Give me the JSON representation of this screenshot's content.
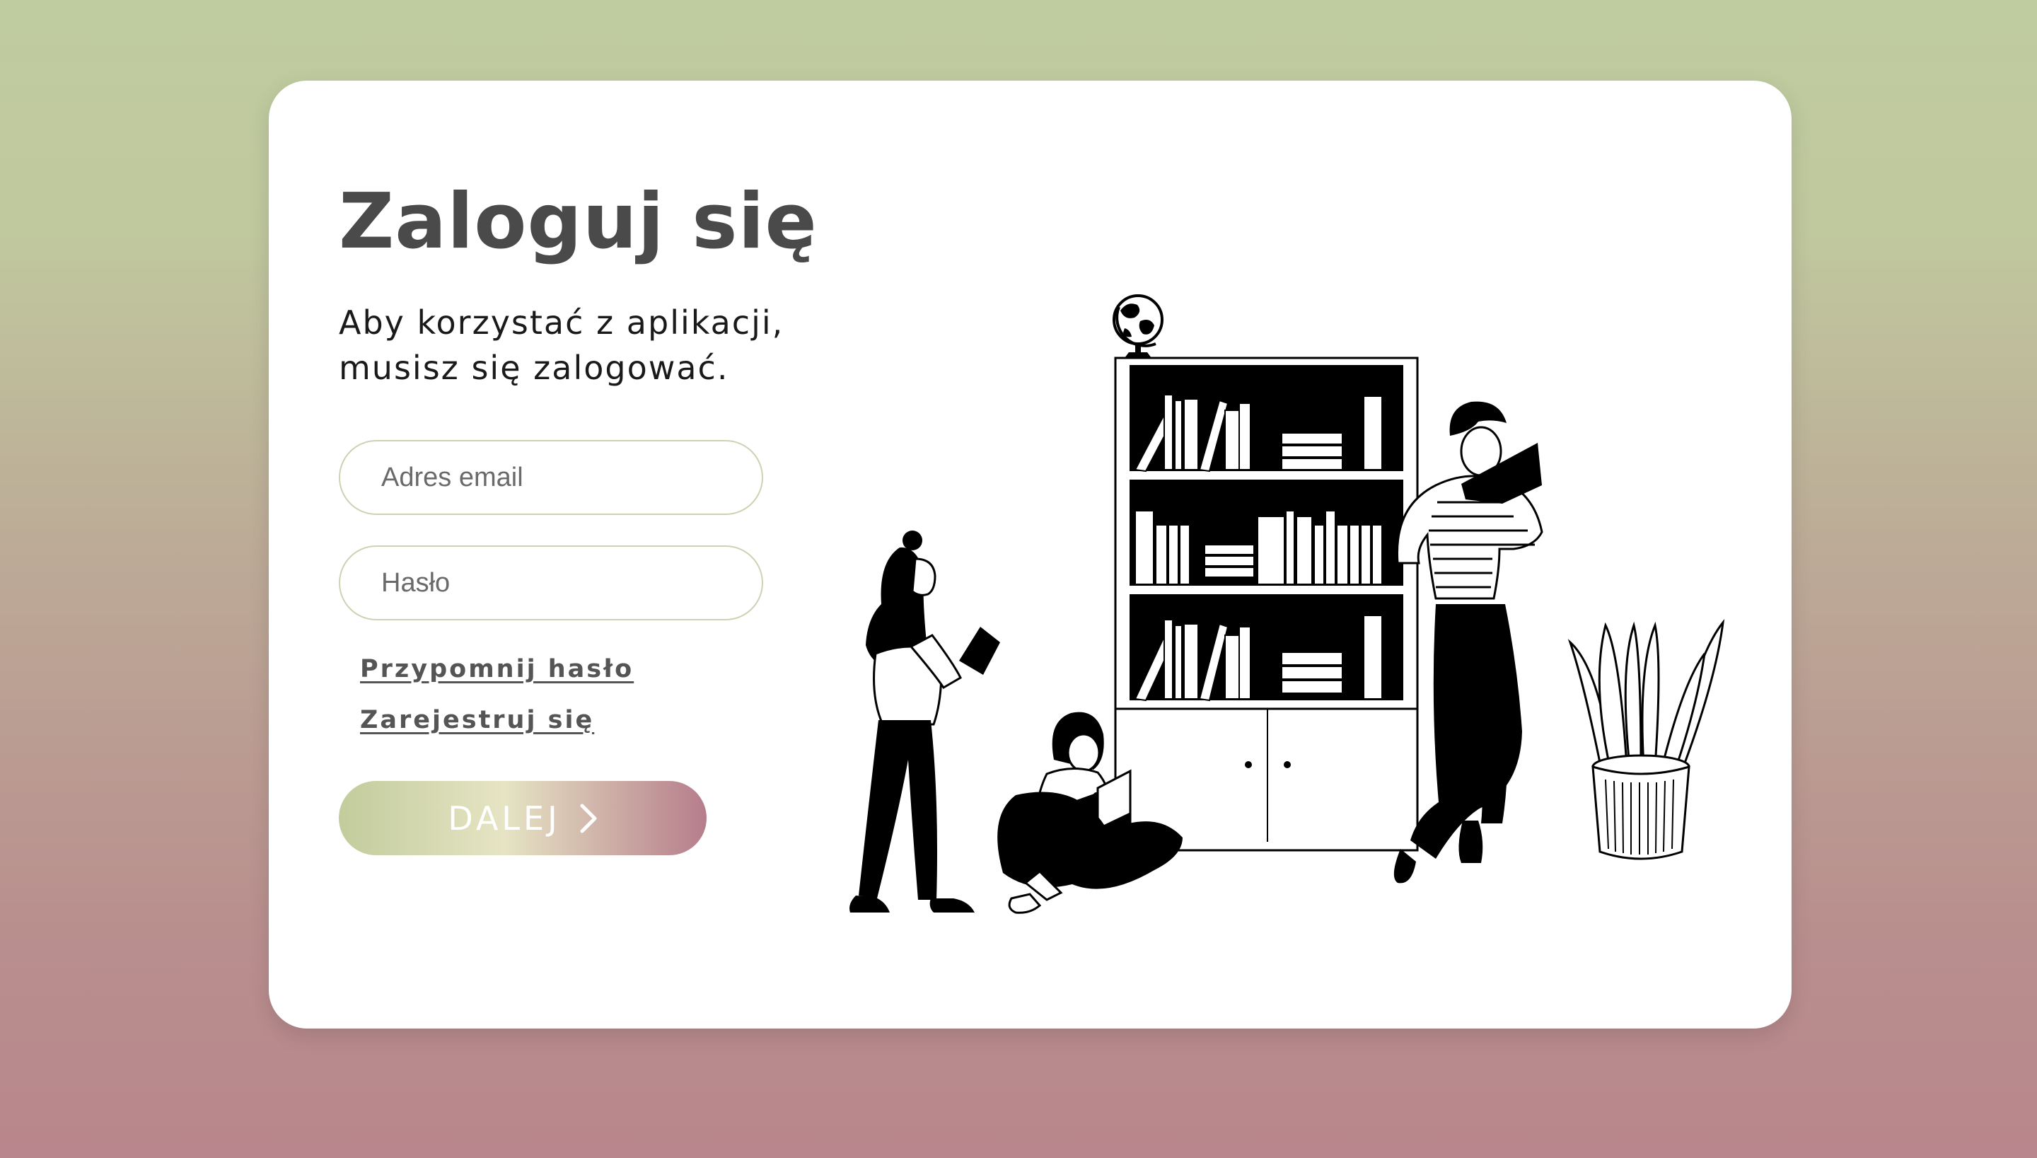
{
  "login": {
    "title": "Zaloguj się",
    "subtitle": "Aby korzystać z aplikacji, musisz się zalogować.",
    "email_placeholder": "Adres email",
    "password_placeholder": "Hasło",
    "remind_password": "Przypomnij hasło",
    "register": "Zarejestruj się",
    "submit_label": "DALEJ",
    "submit_icon": "chevron-right-icon"
  },
  "colors": {
    "background_top": "#bfcc9f",
    "background_bottom": "#b8868c",
    "title": "#4a4a4a",
    "link": "#555555",
    "button_gradient": [
      "#c2cc9c",
      "#e6e4c4",
      "#b67d8b"
    ]
  },
  "illustration": {
    "name": "library-reading-illustration",
    "elements": [
      "globe-icon",
      "bookshelf",
      "reading-woman-standing",
      "reading-woman-sitting",
      "reading-man-leaning",
      "potted-plant"
    ]
  }
}
